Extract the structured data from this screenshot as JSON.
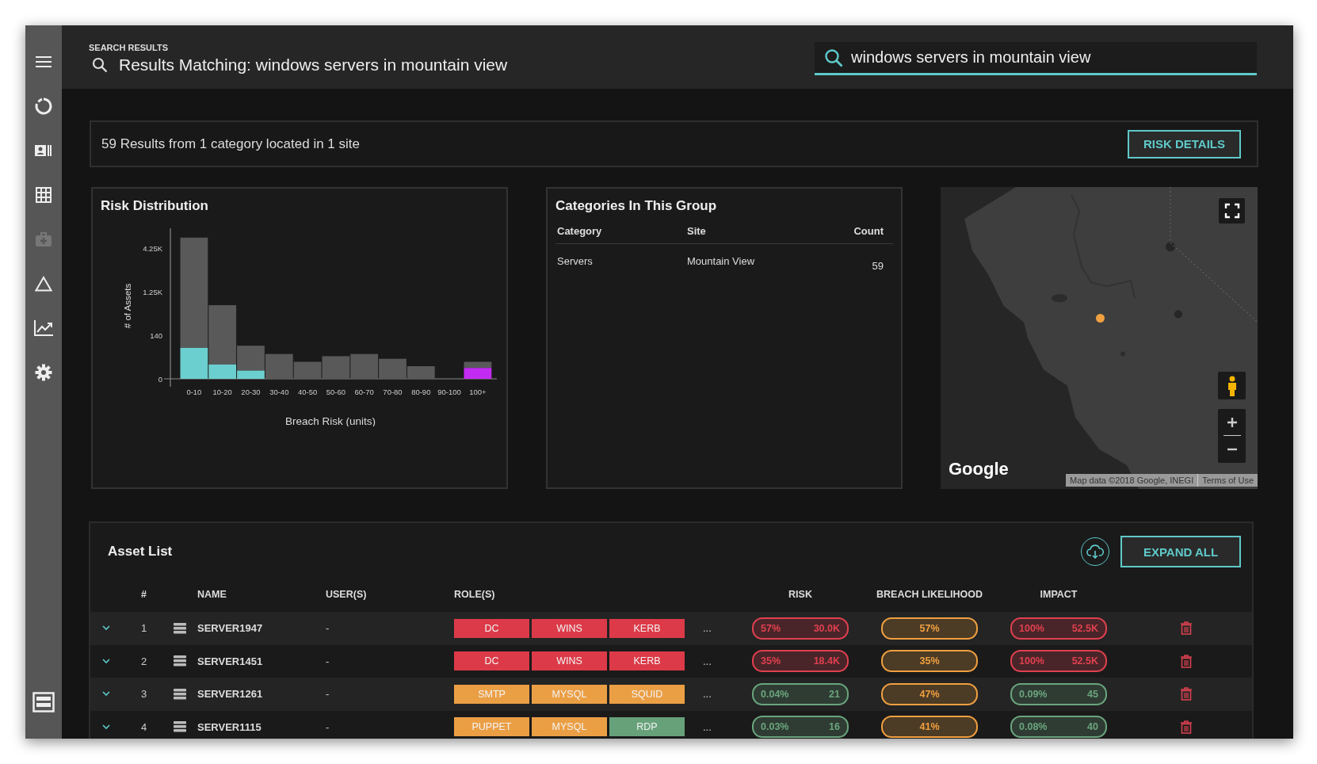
{
  "sidebar": {
    "items": [
      {
        "kind": "menu",
        "disabled": false
      },
      {
        "kind": "donut",
        "disabled": false
      },
      {
        "kind": "id-card",
        "disabled": false
      },
      {
        "kind": "grid",
        "disabled": false
      },
      {
        "kind": "medkit",
        "disabled": true
      },
      {
        "kind": "triangle",
        "disabled": false
      },
      {
        "kind": "chart",
        "disabled": false
      },
      {
        "kind": "gear",
        "disabled": false
      }
    ]
  },
  "header": {
    "eyebrow": "SEARCH RESULTS",
    "title": "Results Matching: windows servers in mountain view"
  },
  "search": {
    "value": "windows servers in mountain view"
  },
  "summary": {
    "text": "59 Results from 1 category located in 1 site",
    "button": "RISK DETAILS"
  },
  "risk_distribution": {
    "title": "Risk Distribution",
    "xlabel": "Breach Risk (units)",
    "ylabel": "# of Assets",
    "y_ticks": [
      "4.25K",
      "1.25K",
      "140",
      "0"
    ],
    "categories": [
      "0-10",
      "10-20",
      "20-30",
      "30-40",
      "40-50",
      "50-60",
      "60-70",
      "70-80",
      "80-90",
      "90-100",
      "100+"
    ]
  },
  "categories": {
    "title": "Categories In This Group",
    "columns": [
      "Category",
      "Site",
      "Count"
    ],
    "rows": [
      [
        "Servers",
        "Mountain View",
        "59"
      ]
    ]
  },
  "map": {
    "kind": "picture",
    "logo": "Google",
    "attribution": "Map data ©2018 Google, INEGI",
    "terms": "Terms of Use"
  },
  "asset_list": {
    "title": "Asset List",
    "button": "EXPAND ALL",
    "columns": [
      "#",
      "NAME",
      "USER(S)",
      "ROLE(S)",
      "RISK",
      "BREACH LIKELIHOOD",
      "IMPACT"
    ],
    "rows": [
      {
        "expanded": false,
        "number": "1",
        "name": "SERVER1947",
        "users": "-",
        "roles": [
          {
            "label": "DC",
            "color": "#dc3a48"
          },
          {
            "label": "WINS",
            "color": "#dc3a48"
          },
          {
            "label": "KERB",
            "color": "#dc3a48"
          }
        ],
        "more": "...",
        "risk": {
          "color": "#e0404f",
          "percent": "57%",
          "value": "30.0K"
        },
        "breach": {
          "color": "#f0a040",
          "percent": "57%"
        },
        "impact": {
          "color": "#e0404f",
          "percent": "100%",
          "value": "52.5K"
        }
      },
      {
        "expanded": false,
        "number": "2",
        "name": "SERVER1451",
        "users": "-",
        "roles": [
          {
            "label": "DC",
            "color": "#dc3a48"
          },
          {
            "label": "WINS",
            "color": "#dc3a48"
          },
          {
            "label": "KERB",
            "color": "#dc3a48"
          }
        ],
        "more": "...",
        "risk": {
          "color": "#e0404f",
          "percent": "35%",
          "value": "18.4K"
        },
        "breach": {
          "color": "#f0a040",
          "percent": "35%"
        },
        "impact": {
          "color": "#e0404f",
          "percent": "100%",
          "value": "52.5K"
        }
      },
      {
        "expanded": false,
        "number": "3",
        "name": "SERVER1261",
        "users": "-",
        "roles": [
          {
            "label": "SMTP",
            "color": "#eb9f45"
          },
          {
            "label": "MYSQL",
            "color": "#eb9f45"
          },
          {
            "label": "SQUID",
            "color": "#eb9f45"
          }
        ],
        "more": "...",
        "risk": {
          "color": "#6aa57e",
          "percent": "0.04%",
          "value": "21"
        },
        "breach": {
          "color": "#f0a040",
          "percent": "47%"
        },
        "impact": {
          "color": "#6aa57e",
          "percent": "0.09%",
          "value": "45"
        }
      },
      {
        "expanded": false,
        "number": "4",
        "name": "SERVER1115",
        "users": "-",
        "roles": [
          {
            "label": "PUPPET",
            "color": "#eb9f45"
          },
          {
            "label": "MYSQL",
            "color": "#eb9f45"
          },
          {
            "label": "RDP",
            "color": "#67a17a"
          }
        ],
        "more": "...",
        "risk": {
          "color": "#6aa57e",
          "percent": "0.03%",
          "value": "16"
        },
        "breach": {
          "color": "#f0a040",
          "percent": "41%"
        },
        "impact": {
          "color": "#6aa57e",
          "percent": "0.08%",
          "value": "40"
        }
      }
    ]
  }
}
